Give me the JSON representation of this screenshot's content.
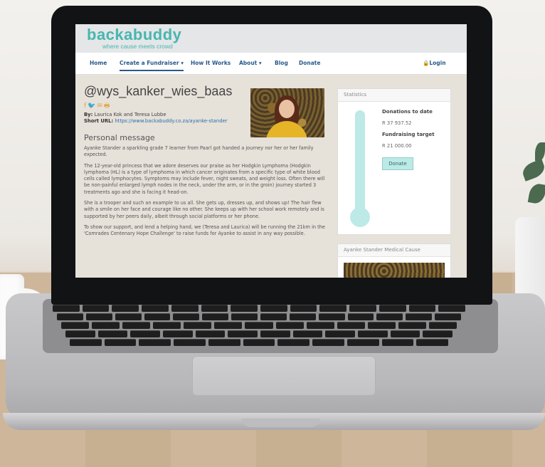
{
  "site": {
    "logo": "backabuddy",
    "tagline": "where cause meets crowd"
  },
  "nav": {
    "items": [
      "Home",
      "Create a Fundraiser ▾",
      "How It Works",
      "About ▾",
      "Blog",
      "Donate"
    ],
    "login": "🔒Login"
  },
  "campaign": {
    "title": "@wys_kanker_wies_baas",
    "share_icons": "f🐦✉🖶",
    "by_label": "By:",
    "by_value": "Laurica Kok and Teresa Lubbe",
    "url_label": "Short URL:",
    "url_value": "https://www.backabuddy.co.za/ayanke-stander",
    "message_heading": "Personal message",
    "paragraphs": [
      "Ayanke Stander a sparkling grade 7 learner from Paarl got handed a journey nor her or her family expected.",
      "The 12-year-old princess that we adore deserves our praise as her Hodgkin Lymphoma (Hodgkin lymphoma (HL) is a type of lymphoma in which cancer originates from a specific type of white blood cells called lymphocytes. Symptoms may include fever, night sweats, and weight loss. Often there will be non-painful enlarged lymph nodes in the neck, under the arm, or in the groin) journey started 3 treatments ago and she is facing it head-on.",
      "She is a trooper and such an example to us all. She gets up, dresses up, and shows up! The hair flew with a smile on her face and courage like no other. She keeps up with her school work remotely and is supported by her peers daily, albeit through social platforms or her phone.",
      "To show our support, and lend a helping hand, we (Teresa and Laurica) will be running the 21km in the 'Comrades Centenary Hope Challenge' to raise funds for Ayanke to assist in any way possible."
    ]
  },
  "stats": {
    "heading": "Statistics",
    "donations_label": "Donations to date",
    "donations_value": "R 37 937.52",
    "target_label": "Fundraising target",
    "target_value": "R 21 000.00",
    "donate_button": "Donate"
  },
  "cause": {
    "heading": "Ayanke Stander Medical Cause"
  }
}
